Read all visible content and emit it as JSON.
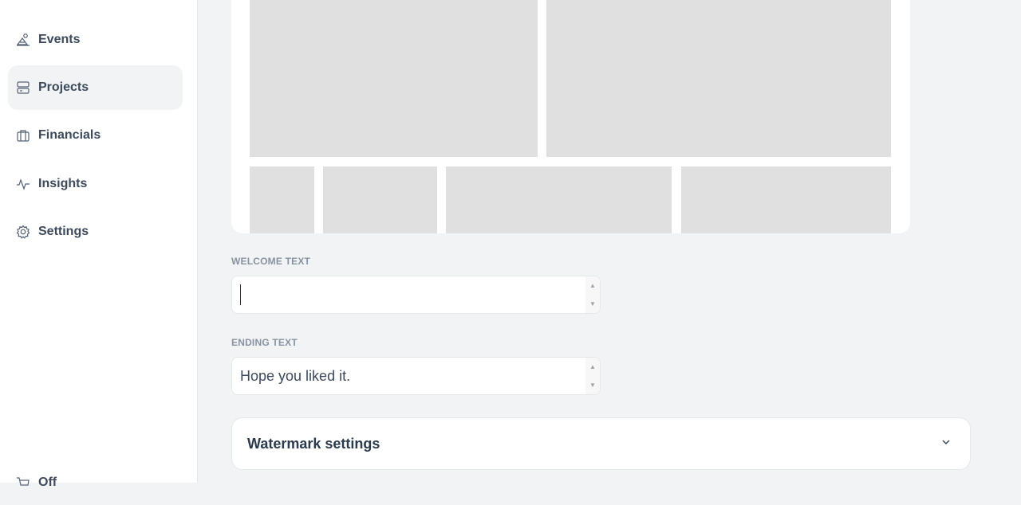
{
  "sidebar": {
    "items": [
      {
        "label": "Events",
        "icon": "events-icon",
        "active": false
      },
      {
        "label": "Projects",
        "icon": "projects-icon",
        "active": true
      },
      {
        "label": "Financials",
        "icon": "financials-icon",
        "active": false
      },
      {
        "label": "Insights",
        "icon": "insights-icon",
        "active": false
      },
      {
        "label": "Settings",
        "icon": "gear-icon",
        "active": false
      },
      {
        "label": "Off",
        "icon": "cart-icon",
        "active": false
      }
    ]
  },
  "form": {
    "welcome_label": "WELCOME TEXT",
    "welcome_value": "",
    "ending_label": "ENDING TEXT",
    "ending_value": "Hope you liked it.",
    "watermark_title": "Watermark settings"
  },
  "colors": {
    "sidebar_bg": "#ffffff",
    "page_bg": "#f2f3f5",
    "placeholder": "#e0e0e0",
    "text": "#2b3a4c"
  }
}
